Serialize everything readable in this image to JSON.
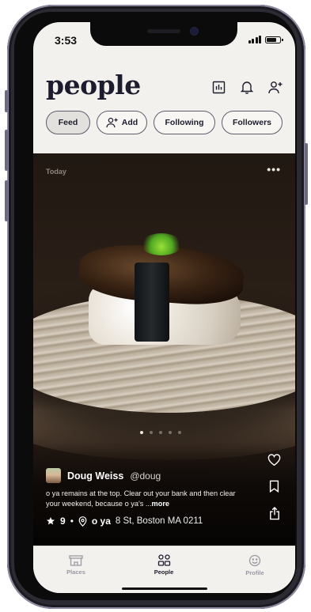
{
  "status": {
    "time": "3:53"
  },
  "header": {
    "title": "people"
  },
  "header_icons": [
    "chart-icon",
    "bell-icon",
    "add-person-icon"
  ],
  "chips": [
    {
      "label": "Feed",
      "active": true
    },
    {
      "label": "Add",
      "icon": "add-person-icon"
    },
    {
      "label": "Following"
    },
    {
      "label": "Followers"
    }
  ],
  "post": {
    "date_label": "Today",
    "menu_glyph": "•••",
    "user_name": "Doug Weiss",
    "user_handle": "@doug",
    "caption": "o ya remains at the top. Clear out your bank and then clear your weekend, because o ya's ...",
    "more_label": "more",
    "rating": "9",
    "separator": "•",
    "place_name": "o ya",
    "place_address": "8 St, Boston MA 0211",
    "carousel": {
      "count": 5,
      "active": 0
    }
  },
  "tabs": [
    {
      "label": "Places",
      "icon": "places-icon"
    },
    {
      "label": "People",
      "icon": "people-icon",
      "active": true
    },
    {
      "label": "Profile",
      "icon": "smiley-icon"
    }
  ],
  "colors": {
    "text_dark": "#1d1c2e",
    "screen_bg": "#f2f1ed",
    "inactive_tab": "#9a98a0"
  }
}
